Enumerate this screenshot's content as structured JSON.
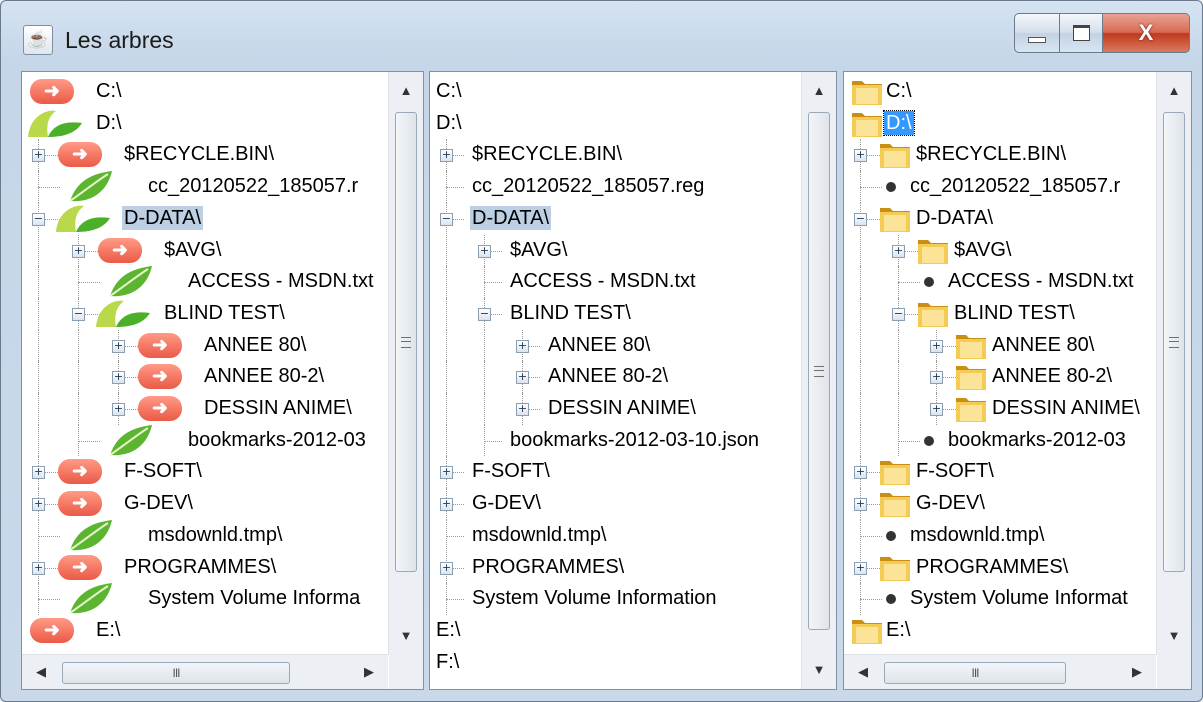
{
  "window": {
    "title": "Les arbres",
    "icon": "java-cup-icon",
    "buttons": {
      "minimize": "minimize",
      "maximize": "maximize",
      "close": "X"
    }
  },
  "scrollbars": {
    "up": "▲",
    "down": "▼",
    "left": "◀",
    "right": "▶",
    "grip": "III"
  },
  "tree_rows": [
    {
      "label": "C:\\",
      "level": 0,
      "expander": "",
      "state": "none"
    },
    {
      "label": "D:\\",
      "level": 0,
      "expander": "",
      "state": "open"
    },
    {
      "label": "$RECYCLE.BIN\\",
      "level": 1,
      "expander": "+",
      "state": "closed"
    },
    {
      "label": "cc_20120522_185057.reg",
      "level": 1,
      "expander": "",
      "state": "leaf"
    },
    {
      "label": "D-DATA\\",
      "level": 1,
      "expander": "−",
      "state": "open"
    },
    {
      "label": "$AVG\\",
      "level": 2,
      "expander": "+",
      "state": "closed"
    },
    {
      "label": "ACCESS - MSDN.txt",
      "level": 2,
      "expander": "",
      "state": "leaf"
    },
    {
      "label": "BLIND TEST\\",
      "level": 2,
      "expander": "−",
      "state": "open"
    },
    {
      "label": "ANNEE 80\\",
      "level": 3,
      "expander": "+",
      "state": "closed"
    },
    {
      "label": "ANNEE 80-2\\",
      "level": 3,
      "expander": "+",
      "state": "closed"
    },
    {
      "label": "DESSIN ANIME\\",
      "level": 3,
      "expander": "+",
      "state": "closed"
    },
    {
      "label": "bookmarks-2012-03-10.json",
      "level": 2,
      "expander": "",
      "state": "leaf"
    },
    {
      "label": "F-SOFT\\",
      "level": 1,
      "expander": "+",
      "state": "closed"
    },
    {
      "label": "G-DEV\\",
      "level": 1,
      "expander": "+",
      "state": "closed"
    },
    {
      "label": "msdownld.tmp\\",
      "level": 1,
      "expander": "",
      "state": "leaf"
    },
    {
      "label": "PROGRAMMES\\",
      "level": 1,
      "expander": "+",
      "state": "closed"
    },
    {
      "label": "System Volume Information",
      "level": 1,
      "expander": "",
      "state": "leaf"
    },
    {
      "label": "E:\\",
      "level": 0,
      "expander": "",
      "state": "none"
    },
    {
      "label": "F:\\",
      "level": 0,
      "expander": "",
      "state": "none"
    }
  ],
  "panes": [
    {
      "id": "pane1",
      "icon_style": "arrow-leaf",
      "visible_rows": 18,
      "selected_row": 4,
      "selection": "gray",
      "truncate": {
        "3": "cc_20120522_185057.r",
        "11": "bookmarks-2012-03",
        "16": "System Volume Informa"
      }
    },
    {
      "id": "pane2",
      "icon_style": "none",
      "visible_rows": 19,
      "selected_row": 4,
      "selection": "gray",
      "truncate": {}
    },
    {
      "id": "pane3",
      "icon_style": "folder-dot",
      "visible_rows": 18,
      "selected_row": 1,
      "selection": "blue",
      "truncate": {
        "3": "cc_20120522_185057.r",
        "11": "bookmarks-2012-03",
        "16": "System Volume Informat"
      }
    }
  ],
  "icon_names": {
    "arrow": "arrow-folder-icon",
    "leaf": "leaf-file-icon",
    "open_leaf": "open-folder-leaf-icon",
    "folder": "folder-icon",
    "dot": "file-bullet-icon"
  },
  "colors": {
    "arrow": "#ea5a47",
    "leaf": "#4caf2a",
    "folder": "#e8b52c",
    "selection_gray": "#bccfe3",
    "selection_blue": "#3399ff"
  }
}
